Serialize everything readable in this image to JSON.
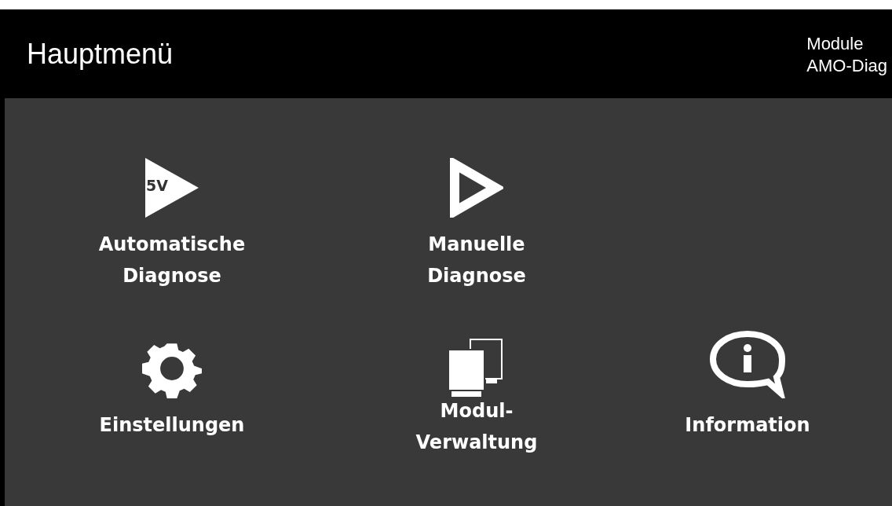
{
  "header": {
    "title": "Hauptmenü",
    "module_label": "Module",
    "module_name": "AMO-Diag"
  },
  "tiles": [
    {
      "kind": "auto",
      "badge": "5V",
      "label": "Automatische\nDiagnose"
    },
    {
      "kind": "manual",
      "label": "Manuelle\nDiagnose"
    },
    {
      "kind": "empty"
    },
    {
      "kind": "settings",
      "label": "Einstellungen"
    },
    {
      "kind": "modules",
      "label": "Modul-\nVerwaltung"
    },
    {
      "kind": "info",
      "label": "Information"
    }
  ]
}
